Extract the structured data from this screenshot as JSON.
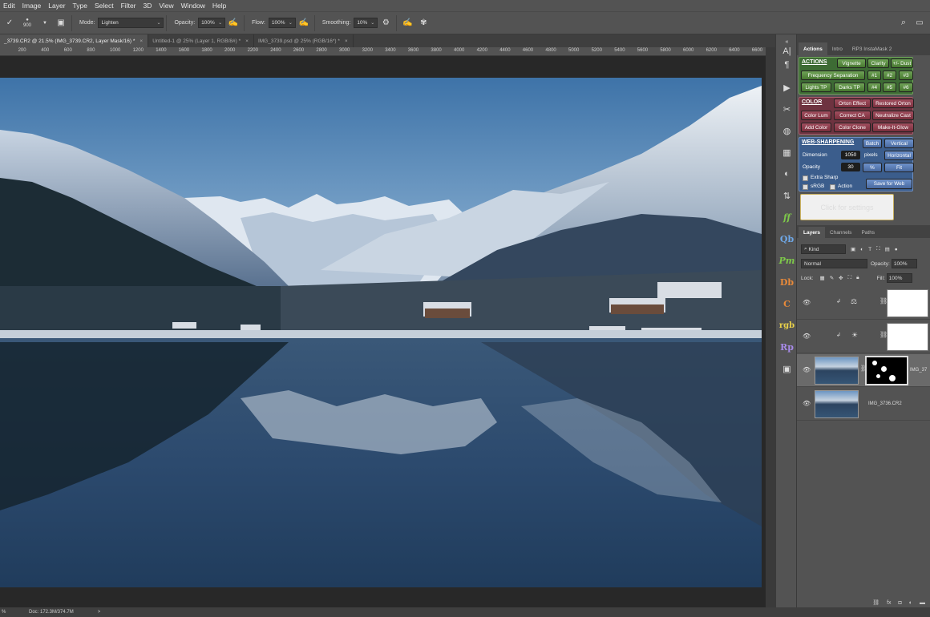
{
  "menu": [
    "Edit",
    "Image",
    "Layer",
    "Type",
    "Select",
    "Filter",
    "3D",
    "View",
    "Window",
    "Help"
  ],
  "options": {
    "brush_size": "900",
    "mode_label": "Mode:",
    "mode_value": "Lighten",
    "opacity_label": "Opacity:",
    "opacity_value": "100%",
    "flow_label": "Flow:",
    "flow_value": "100%",
    "smoothing_label": "Smoothing:",
    "smoothing_value": "10%"
  },
  "tabs": [
    {
      "label": "_3739.CR2 @ 21.5% (IMG_3739.CR2, Layer Mask/16) *",
      "active": true
    },
    {
      "label": "Untitled-1 @ 25% (Layer 1, RGB/8#) *",
      "active": false
    },
    {
      "label": "IMG_3739.psd @ 25% (RGB/16*) *",
      "active": false
    }
  ],
  "ruler_ticks": [
    "0",
    "200",
    "400",
    "600",
    "800",
    "1000",
    "1200",
    "1400",
    "1600",
    "1800",
    "2000",
    "2200",
    "2400",
    "2600",
    "2800",
    "3000",
    "3200",
    "3400",
    "3600",
    "3800",
    "4000",
    "4200",
    "4400",
    "4600",
    "4800",
    "5000",
    "5200",
    "5400",
    "5600",
    "5800",
    "6000",
    "6200",
    "6400",
    "6600"
  ],
  "status": {
    "zoom": "%",
    "doc": "Doc: 172.3M/374.7M",
    "arrow": ">"
  },
  "panel_tabs": [
    "Actions",
    "Intro",
    "RP3 InstaMask 2"
  ],
  "actions": {
    "header": "ACTIONS",
    "buttons": [
      "Vignette",
      "Clarity",
      "+/- Dust",
      "Frequency Separation",
      "#1",
      "#2",
      "#3",
      "Lights TP",
      "Darks TP",
      "#4",
      "#5",
      "#6"
    ]
  },
  "color": {
    "header": "COLOR",
    "buttons": [
      "Orton Effect",
      "Restored Orton",
      "Color Lum",
      "Correct CA",
      "Neutralize Cast",
      "Add Color",
      "Color Clone",
      "Make-It-Glow"
    ]
  },
  "web": {
    "header": "WEB-SHARPENING",
    "batch": "Batch",
    "vertical": "Vertical",
    "dimension_label": "Dimension",
    "dimension_value": "1050",
    "pixels_label": "pixels",
    "horizontal": "Horizontal",
    "opacity_label": "Opacity",
    "opacity_value": "30",
    "pct": "%",
    "fit": "Fit",
    "extra_sharp": "Extra Sharp",
    "srgb": "sRGB",
    "action": "Action",
    "save": "Save for Web"
  },
  "settings_label": "Click for settings",
  "layers_tabs": [
    "Layers",
    "Channels",
    "Paths"
  ],
  "layers": {
    "kind": "Kind",
    "blend": "Normal",
    "opacity_label": "Opacity:",
    "opacity_value": "100%",
    "lock_label": "Lock:",
    "fill_label": "Fill:",
    "fill_value": "100%",
    "items": [
      {
        "name": "",
        "type": "levels"
      },
      {
        "name": "",
        "type": "brightness"
      },
      {
        "name": "IMG_37",
        "type": "image-mask"
      },
      {
        "name": "IMG_3736.CR2",
        "type": "image"
      }
    ]
  },
  "strip_icons": [
    "Ab",
    "Qb",
    "Pm",
    "Db",
    "C",
    "rgb",
    "Rp"
  ],
  "colors": {
    "accent_green": "#5c8e43",
    "accent_red": "#8a3e4e",
    "accent_blue": "#5a7fb6"
  }
}
